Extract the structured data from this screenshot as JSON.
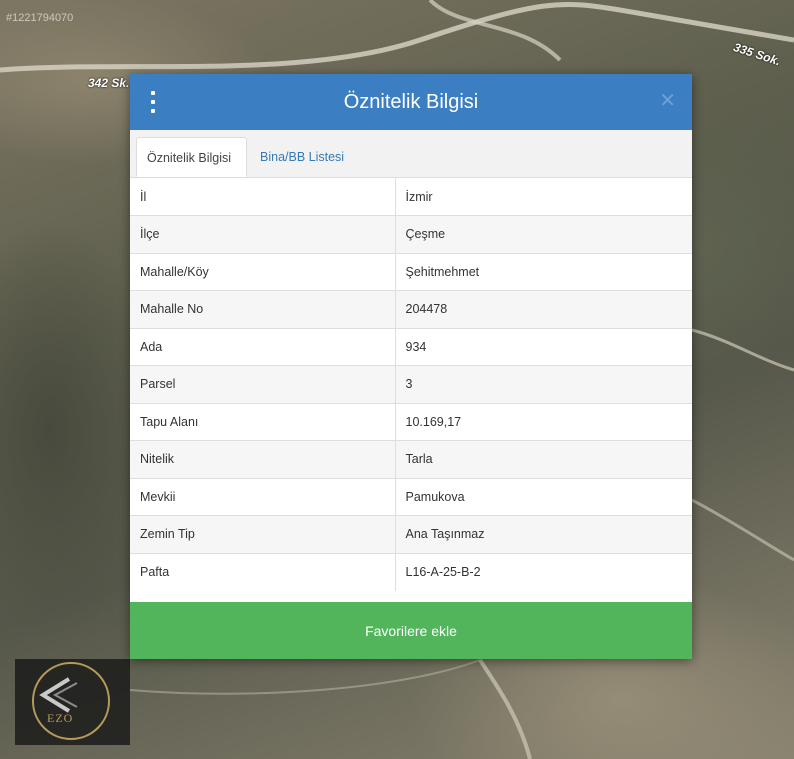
{
  "map": {
    "id_text": "#1221794070",
    "street_1": "342 Sk.",
    "street_2": "335 Sok."
  },
  "modal": {
    "title": "Öznitelik Bilgisi",
    "menu_icon": "kebab-menu-icon",
    "close_icon": "close-icon",
    "tabs": [
      {
        "label": "Öznitelik Bilgisi",
        "active": true
      },
      {
        "label": "Bina/BB Listesi",
        "active": false
      }
    ],
    "rows": [
      {
        "key": "İl",
        "value": "İzmir"
      },
      {
        "key": "İlçe",
        "value": "Çeşme"
      },
      {
        "key": "Mahalle/Köy",
        "value": "Şehitmehmet"
      },
      {
        "key": "Mahalle No",
        "value": "204478"
      },
      {
        "key": "Ada",
        "value": "934"
      },
      {
        "key": "Parsel",
        "value": "3"
      },
      {
        "key": "Tapu Alanı",
        "value": "10.169,17"
      },
      {
        "key": "Nitelik",
        "value": "Tarla"
      },
      {
        "key": "Mevkii",
        "value": "Pamukova"
      },
      {
        "key": "Zemin Tip",
        "value": "Ana Taşınmaz"
      },
      {
        "key": "Pafta",
        "value": "L16-A-25-B-2"
      }
    ],
    "favorite_button": "Favorilere ekle"
  },
  "logo": {
    "text": "EZO"
  },
  "colors": {
    "header": "#3b7fc2",
    "button": "#52b45b",
    "tab_link": "#337ab7"
  }
}
